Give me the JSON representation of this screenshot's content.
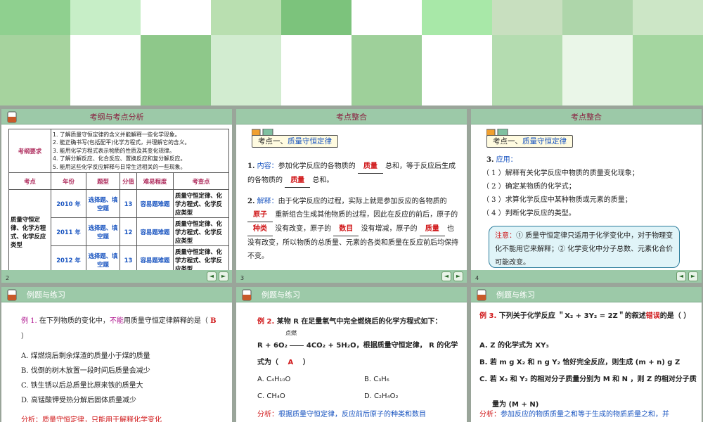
{
  "slides": {
    "s1": {
      "head_title": "考纲与考点分析",
      "page": "2",
      "req_label": "考纲要求",
      "requirements": [
        "1. 了解质量守恒定律的含义并能解释一些化学现象。",
        "2. 能正确书写(包括配平)化学方程式，并理解它的含义。",
        "3. 能用化学方程式表示物质的性质及其变化规律。",
        "4. 了解分解反应、化合反应、置换反应和复分解反应。",
        "5. 能用这些化学反应解释与日常生活相关的一些现象。"
      ],
      "headers": [
        "考点",
        "年份",
        "题型",
        "分值",
        "难易程度",
        "考查点"
      ],
      "topic": "质量守恒定律、化学方程式、化学反应类型",
      "rows": [
        {
          "year": "2010 年",
          "type": "选择题、填空题",
          "score": "13",
          "level": "容易题难题",
          "point": "质量守恒定律、化学方程式、化学反应类型"
        },
        {
          "year": "2011 年",
          "type": "选择题、填空题",
          "score": "12",
          "level": "容易题难题",
          "point": "质量守恒定律、化学方程式、化学反应类型"
        },
        {
          "year": "2012 年",
          "type": "选择题、填空题",
          "score": "13",
          "level": "容易题难题",
          "point": "质量守恒定律、化学方程式、化学反应类型"
        }
      ]
    },
    "s2": {
      "head_title": "考点整合",
      "page": "3",
      "kp_prefix": "考点一、",
      "kp_name": "质量守恒定律",
      "p1_num": "1.",
      "p1_label": "内容：",
      "p1_a": "参加化学反应的各物质的",
      "p1_ans1": "质量",
      "p1_b": "总和，等于反应后生成的各物质的",
      "p1_ans2": "质量",
      "p1_c": "总和。",
      "p2_num": "2.",
      "p2_label": "解释：",
      "p2_a": "由于化学反应的过程，实际上就是参加反应的各物质的",
      "p2_ans1": "原子",
      "p2_b": "重新组合生成其他物质的过程，因此在反应的前后，原子的",
      "p2_ans2": "种类",
      "p2_c": "没有改变，原子的",
      "p2_ans3": "数目",
      "p2_d": "没有增减，原子的",
      "p2_ans4": "质量",
      "p2_e": "也没有改变，所以物质的总质量、元素的各类和质量在反应前后均保持不变。"
    },
    "s3": {
      "head_title": "考点整合",
      "page": "4",
      "kp_prefix": "考点一、",
      "kp_name": "质量守恒定律",
      "app_num": "3.",
      "app_label": "应用：",
      "apps": [
        "（ 1 ）解释有关化学反应中物质的质量变化现象；",
        "（ 2 ）确定某物质的化学式；",
        "（ 3 ）求算化学反应中某种物质或元素的质量；",
        "（ 4 ）判断化学反应的类型。"
      ],
      "note_label": "注意：",
      "note_text": "① 质量守恒定律只适用于化学变化中，对于物理变化不能用它来解释；② 化学变化中分子总数、元素化合价可能改变。"
    },
    "s4": {
      "head_title": "例题与练习",
      "ex_label": "例 1.",
      "q_a": "在下列物质的变化中，",
      "q_neg": "不能",
      "q_b": "用质量守恒定律解释的是（",
      "answer": "B",
      "q_c": "）",
      "options": [
        "A. 煤燃烧后剩余煤渣的质量小于煤的质量",
        "B. 伐倒的树木放置一段时间后质量会减少",
        "C. 铁生锈以后总质量比原来铁的质量大",
        "D. 高锰酸钾受热分解后固体质量减少"
      ],
      "analysis": "分析：质量守恒定律，只能用于解释化学变化"
    },
    "s5": {
      "head_title": "例题与练习",
      "ex_label": "例 2.",
      "q_a": "某物 R 在足量氧气中完全燃烧后的化学方程式如下：",
      "condition": "点燃",
      "eq_left": "R + 6O₂",
      "eq_right": "4CO₂ + 5H₂O",
      "q_b": "，根据质量守恒定律， R 的化学式为（",
      "answer": "A",
      "q_c": "）",
      "options": [
        "A. C₄H₁₀O",
        "B. C₃H₆",
        "C. CH₄O",
        "D. C₂H₄O₂"
      ],
      "analysis_label": "分析：",
      "analysis": "根据质量守恒定律，反应前后原子的种类和数目"
    },
    "s6": {
      "head_title": "例题与练习",
      "ex_label": "例 3.",
      "q_a": "下列关于化学反应 ＂X₂ + 3Y₂ = 2Z＂的叙述",
      "q_neg": "错误",
      "q_b": "的是（",
      "q_c": "）",
      "options": [
        "A. Z 的化学式为 XY₃",
        "B. 若 m g X₂ 和 n g Y₂ 恰好完全反应，则生成 (m + n) g Z",
        "C. 若 X₂ 和 Y₂ 的相对分子质量分别为 M 和 N ，则 Z 的相对分子质",
        "量为 (M + N)"
      ],
      "analysis_label": "分析：",
      "analysis": "参加反应的物质质量之和等于生成的物质质量之和，并"
    }
  },
  "colors": {
    "header_green": "#9cc9a8",
    "title_red": "#8a2040",
    "blue": "#1a55c0",
    "red": "#d0181a"
  }
}
